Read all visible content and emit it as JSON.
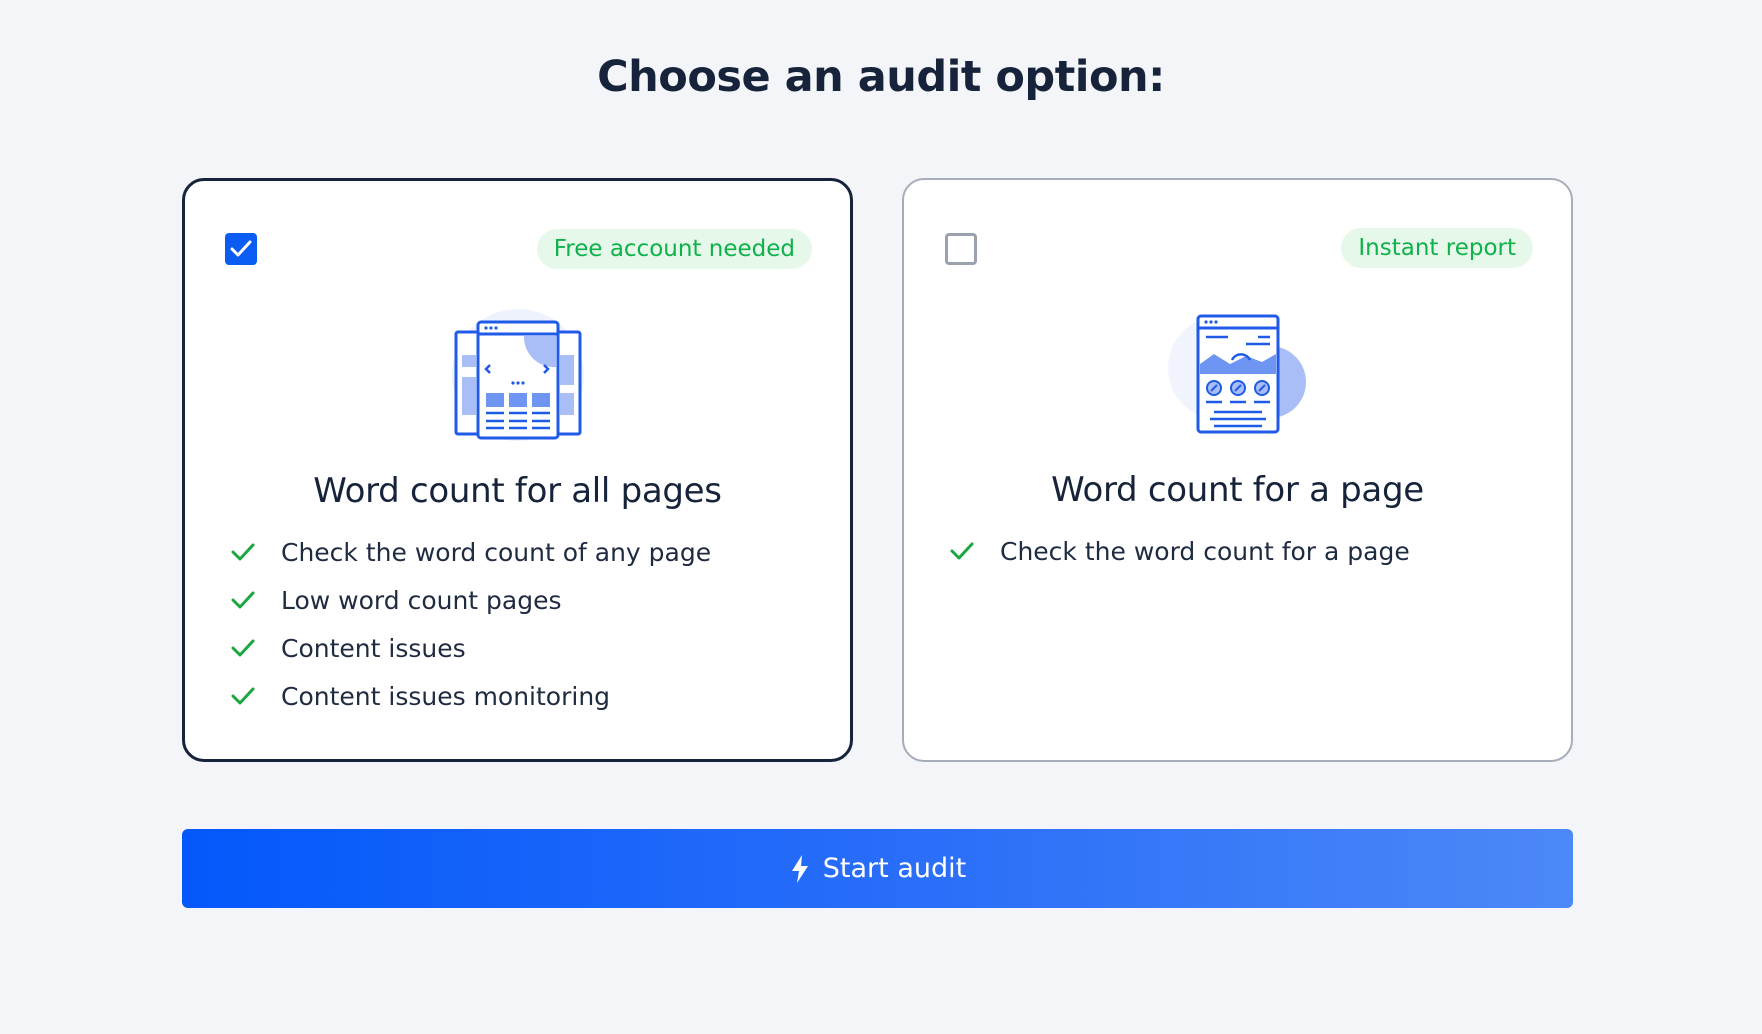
{
  "page": {
    "title": "Choose an audit option:"
  },
  "options": [
    {
      "selected": true,
      "badge": "Free account needed",
      "title": "Word count for all pages",
      "illustration": "multi-page-browser-illustration",
      "features": [
        "Check the word count of any page",
        "Low word count pages",
        "Content issues",
        "Content issues monitoring"
      ]
    },
    {
      "selected": false,
      "badge": "Instant report",
      "title": "Word count for a page",
      "illustration": "single-page-document-illustration",
      "features": [
        "Check the word count for a page"
      ]
    }
  ],
  "start_button": {
    "label": "Start audit",
    "icon": "lightning-bolt-icon"
  },
  "colors": {
    "background": "#f3f5f8",
    "text": "#16233a",
    "accent": "#0b5cf2",
    "badge_bg": "#e6f8ea",
    "badge_text": "#0fb14a",
    "check": "#1aa742",
    "illustration_blue": "#1f5ae8",
    "illustration_light": "#a9bdf7"
  }
}
